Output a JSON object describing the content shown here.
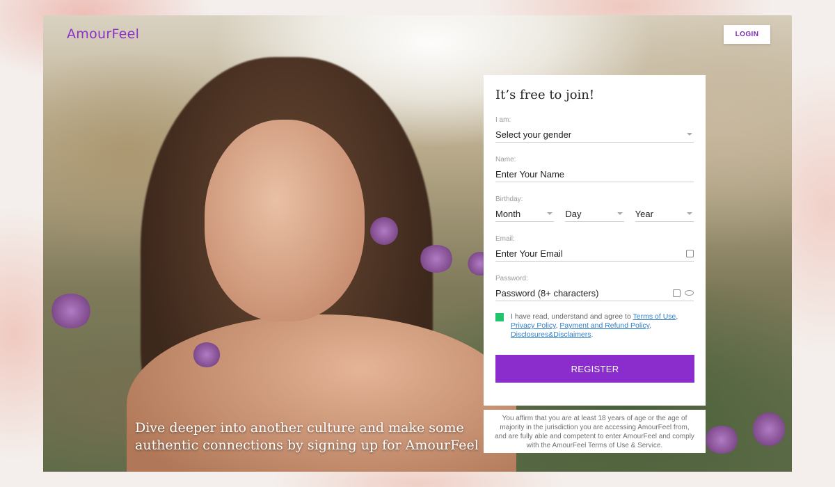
{
  "brand": {
    "logo": "AmourFeel"
  },
  "header": {
    "login_label": "LOGIN"
  },
  "hero": {
    "tagline": "Dive deeper into another culture and make some authentic connections by signing up for AmourFeel"
  },
  "form": {
    "title": "It’s free to join!",
    "gender": {
      "label": "I am:",
      "value": "Select your gender"
    },
    "name": {
      "label": "Name:",
      "placeholder": "Enter Your Name"
    },
    "birthday": {
      "label": "Birthday:",
      "month": "Month",
      "day": "Day",
      "year": "Year"
    },
    "email": {
      "label": "Email:",
      "placeholder": "Enter Your Email"
    },
    "password": {
      "label": "Password:",
      "placeholder": "Password (8+ characters)"
    },
    "agree": {
      "text": "I have read, understand and agree to",
      "terms": "Terms of Use",
      "privacy": "Privacy Policy",
      "payment": "Payment and Refund Policy",
      "disclosures": "Disclosures&Disclaimers"
    },
    "register_label": "REGISTER"
  },
  "disclaimer": "You affirm that you are at least 18 years of age or the age of majority in the jurisdiction you are accessing AmourFeel from, and are fully able and competent to enter AmourFeel and comply with the AmourFeel Terms of Use & Service.",
  "colors": {
    "accent": "#8b2ccc",
    "checkbox": "#1fc46b",
    "link": "#2f7fc9"
  },
  "icons": [
    "caret-down-icon",
    "autofill-icon",
    "eye-icon"
  ]
}
